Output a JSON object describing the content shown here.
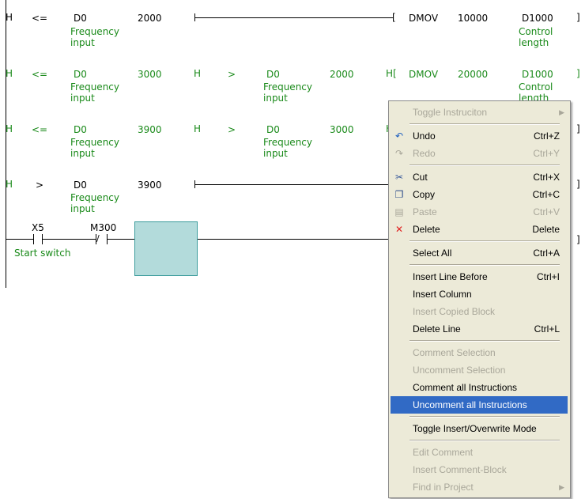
{
  "ladder": {
    "rungs": [
      {
        "cmp": "<=",
        "op1": "D0",
        "op1_comment": [
          "Frequency",
          "input"
        ],
        "op2": "2000",
        "instr": "DMOV",
        "src": "10000",
        "dst": "D1000",
        "dst_comment": [
          "Control",
          "length"
        ]
      },
      {
        "cmp": "<=",
        "op1": "D0",
        "op1_comment": [
          "Frequency",
          "input"
        ],
        "op2": "3000",
        "cmp2": ">",
        "op3": "D0",
        "op3_comment": [
          "Frequency",
          "input"
        ],
        "op4": "2000",
        "instr": "DMOV",
        "src": "20000",
        "dst": "D1000",
        "dst_comment": [
          "Control",
          "length"
        ]
      },
      {
        "cmp": "<=",
        "op1": "D0",
        "op1_comment": [
          "Frequency",
          "input"
        ],
        "op2": "3900",
        "cmp2": ">",
        "op3": "D0",
        "op3_comment": [
          "Frequency",
          "input"
        ],
        "op4": "3000"
      },
      {
        "cmp": ">",
        "op1": "D0",
        "op1_comment": [
          "Frequency",
          "input"
        ],
        "op2": "3900"
      },
      {
        "contact1": "X5",
        "contact1_comment": "Start switch",
        "contact2": "M300"
      }
    ]
  },
  "context_menu": {
    "items": [
      {
        "label": "Toggle Instruciton",
        "shortcut": "",
        "disabled": true,
        "submenu": true,
        "icon": ""
      },
      {
        "sep": true
      },
      {
        "label": "Undo",
        "shortcut": "Ctrl+Z",
        "disabled": false,
        "icon": "undo-icon",
        "glyph": "↶",
        "color": "#1f5fbf"
      },
      {
        "label": "Redo",
        "shortcut": "Ctrl+Y",
        "disabled": true,
        "icon": "redo-icon",
        "glyph": "↷",
        "color": "#a9a79a"
      },
      {
        "sep": true
      },
      {
        "label": "Cut",
        "shortcut": "Ctrl+X",
        "disabled": false,
        "icon": "scissors-icon",
        "glyph": "✂",
        "color": "#3a5a9a"
      },
      {
        "label": "Copy",
        "shortcut": "Ctrl+C",
        "disabled": false,
        "icon": "copy-icon",
        "glyph": "❐",
        "color": "#2a4a8a"
      },
      {
        "label": "Paste",
        "shortcut": "Ctrl+V",
        "disabled": true,
        "icon": "paste-icon",
        "glyph": "▤",
        "color": "#a9a79a"
      },
      {
        "label": "Delete",
        "shortcut": "Delete",
        "disabled": false,
        "icon": "delete-x-icon",
        "glyph": "✕",
        "color": "#e02020"
      },
      {
        "sep": true
      },
      {
        "label": "Select All",
        "shortcut": "Ctrl+A",
        "disabled": false
      },
      {
        "sep": true
      },
      {
        "label": "Insert Line Before",
        "shortcut": "Ctrl+I",
        "disabled": false
      },
      {
        "label": "Insert Column",
        "shortcut": "",
        "disabled": false
      },
      {
        "label": "Insert Copied Block",
        "shortcut": "",
        "disabled": true
      },
      {
        "label": "Delete Line",
        "shortcut": "Ctrl+L",
        "disabled": false
      },
      {
        "sep": true
      },
      {
        "label": "Comment Selection",
        "shortcut": "",
        "disabled": true
      },
      {
        "label": "Uncomment Selection",
        "shortcut": "",
        "disabled": true
      },
      {
        "label": "Comment all Instructions",
        "shortcut": "",
        "disabled": false
      },
      {
        "label": "Uncomment all Instructions",
        "shortcut": "",
        "disabled": false,
        "selected": true
      },
      {
        "sep": true
      },
      {
        "label": "Toggle Insert/Overwrite Mode",
        "shortcut": "",
        "disabled": false
      },
      {
        "sep": true
      },
      {
        "label": "Edit Comment",
        "shortcut": "",
        "disabled": true
      },
      {
        "label": "Insert Comment-Block",
        "shortcut": "",
        "disabled": true
      },
      {
        "label": "Find in Project",
        "shortcut": "",
        "disabled": true,
        "submenu": true
      }
    ]
  }
}
